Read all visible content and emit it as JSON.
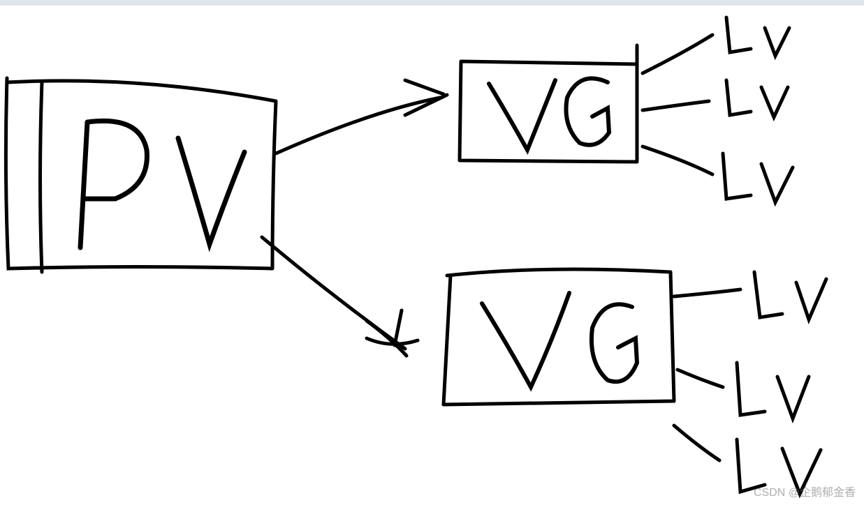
{
  "diagram": {
    "nodes": {
      "pv": {
        "label": "PV"
      },
      "vg1": {
        "label": "VG"
      },
      "vg2": {
        "label": "VG"
      },
      "lv1a": {
        "label": "LV"
      },
      "lv1b": {
        "label": "LV"
      },
      "lv1c": {
        "label": "LV"
      },
      "lv2a": {
        "label": "LV"
      },
      "lv2b": {
        "label": "LV"
      },
      "lv2c": {
        "label": "LV"
      }
    },
    "edges": [
      {
        "from": "pv",
        "to": "vg1"
      },
      {
        "from": "pv",
        "to": "vg2"
      },
      {
        "from": "vg1",
        "to": "lv1a"
      },
      {
        "from": "vg1",
        "to": "lv1b"
      },
      {
        "from": "vg1",
        "to": "lv1c"
      },
      {
        "from": "vg2",
        "to": "lv2a"
      },
      {
        "from": "vg2",
        "to": "lv2b"
      },
      {
        "from": "vg2",
        "to": "lv2c"
      }
    ]
  },
  "watermark": "CSDN @企鹅郁金香"
}
